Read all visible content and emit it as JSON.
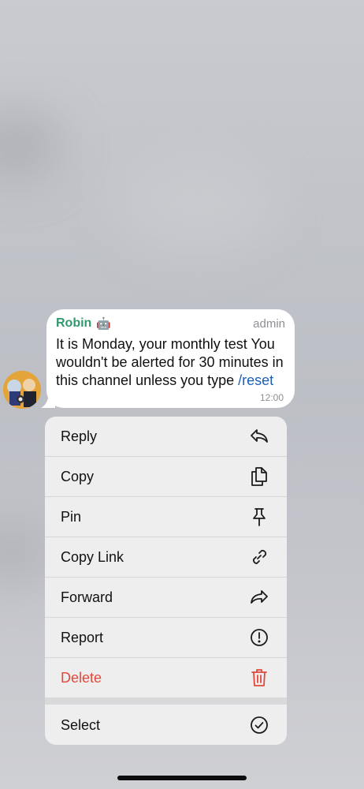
{
  "message": {
    "sender": "Robin",
    "sender_badge": "🤖",
    "role": "admin",
    "text_main": "It is Monday, your monthly test You wouldn't be alerted for 30 minutes in this channel unless you type ",
    "command": "/reset",
    "time": "12:00"
  },
  "menu": {
    "items": [
      {
        "label": "Reply",
        "icon": "reply-icon"
      },
      {
        "label": "Copy",
        "icon": "copy-icon"
      },
      {
        "label": "Pin",
        "icon": "pin-icon"
      },
      {
        "label": "Copy Link",
        "icon": "link-icon"
      },
      {
        "label": "Forward",
        "icon": "forward-icon"
      },
      {
        "label": "Report",
        "icon": "report-icon"
      },
      {
        "label": "Delete",
        "icon": "trash-icon"
      },
      {
        "label": "Select",
        "icon": "checkmark-circle-icon"
      }
    ]
  },
  "colors": {
    "sender_name": "#2f9a6d",
    "command_link": "#1d5fb5",
    "danger": "#e0493b",
    "menu_background": "#eeeeef"
  }
}
